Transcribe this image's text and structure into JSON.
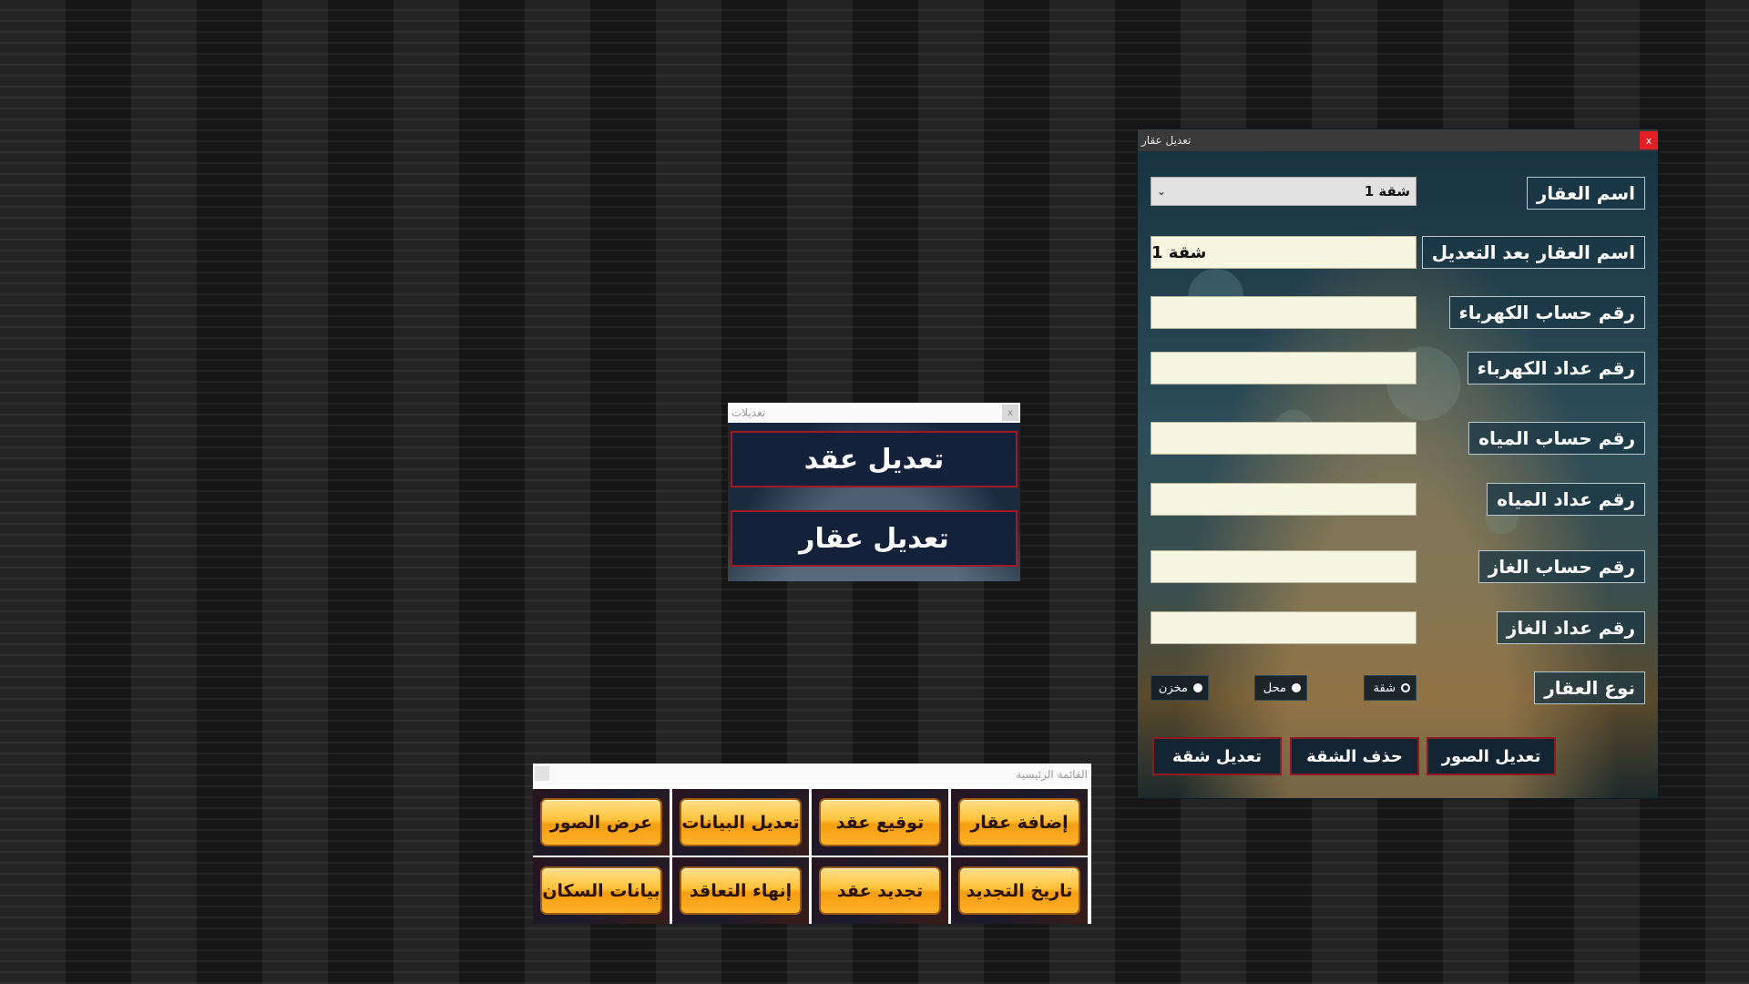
{
  "edit_property_window": {
    "title": "تعديل عقار",
    "close_label": "x",
    "labels": {
      "property_name": "اسم العقار",
      "property_name_after": "اسم العقار بعد التعديل",
      "electricity_account": "رقم حساب الكهرباء",
      "electricity_meter": "رقم عداد الكهرباء",
      "water_account": "رقم حساب المياه",
      "water_meter": "رقم عداد المياه",
      "gas_account": "رقم حساب الغاز",
      "gas_meter": "رقم عداد الغاز",
      "property_type": "نوع العقار"
    },
    "property_select_value": "شقة 1",
    "property_name_after_value": "شقة 1",
    "electricity_account_value": "",
    "electricity_meter_value": "",
    "water_account_value": "",
    "water_meter_value": "",
    "gas_account_value": "",
    "gas_meter_value": "",
    "type_options": {
      "apartment": "شقة",
      "shop": "محل",
      "warehouse": "مخزن"
    },
    "buttons": {
      "edit_photos": "تعديل الصور",
      "delete_apartment": "حذف الشقة",
      "edit_apartment": "تعديل شقة"
    }
  },
  "modifications_window": {
    "title": "تعديلات",
    "close_label": "x",
    "edit_contract": "تعديل عقد",
    "edit_property": "تعديل عقار"
  },
  "main_menu_window": {
    "title": "القائمة الرئيسية",
    "buttons": {
      "add_property": "إضافة عقار",
      "sign_contract": "توقيع عقد",
      "edit_data": "تعديل البيانات",
      "view_photos": "عرض الصور",
      "renewal_date": "تاريخ التجديد",
      "renew_contract": "تجديد عقد",
      "end_contract": "إنهاء التعاقد",
      "tenants_data": "بيانات السكان"
    }
  }
}
